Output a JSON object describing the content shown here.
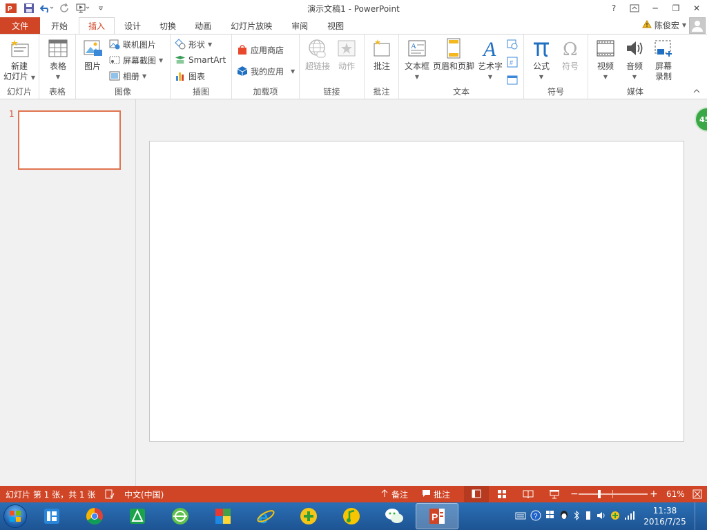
{
  "window": {
    "title": "演示文稿1 - PowerPoint",
    "help": "?",
    "minimize": "─",
    "restore": "❐",
    "close": "✕"
  },
  "tabs": [
    {
      "label": "文件"
    },
    {
      "label": "开始"
    },
    {
      "label": "插入"
    },
    {
      "label": "设计"
    },
    {
      "label": "切换"
    },
    {
      "label": "动画"
    },
    {
      "label": "幻灯片放映"
    },
    {
      "label": "审阅"
    },
    {
      "label": "视图"
    }
  ],
  "user": {
    "name": "陈俊宏"
  },
  "ribbon": {
    "groups": {
      "slides": "幻灯片",
      "tables": "表格",
      "images": "图像",
      "illustrations": "插图",
      "addins": "加载项",
      "links": "链接",
      "comments": "批注",
      "text": "文本",
      "symbols": "符号",
      "media": "媒体"
    },
    "buttons": {
      "new_slide_1": "新建",
      "new_slide_2": "幻灯片",
      "table": "表格",
      "picture": "图片",
      "online_pictures": "联机图片",
      "screenshot": "屏幕截图",
      "album": "相册",
      "shapes": "形状",
      "smartart": "SmartArt",
      "chart": "图表",
      "store": "应用商店",
      "my_apps": "我的应用",
      "hyperlink": "超链接",
      "action": "动作",
      "comment": "批注",
      "textbox": "文本框",
      "header_footer": "页眉和页脚",
      "wordart": "艺术字",
      "equation": "公式",
      "symbol": "符号",
      "video": "视频",
      "audio": "音频",
      "screen_recording_1": "屏幕",
      "screen_recording_2": "录制"
    }
  },
  "slides_pane": {
    "slide_number": "1"
  },
  "badge": {
    "value": "45"
  },
  "status": {
    "slide_info": "幻灯片 第 1 张，共 1 张",
    "language": "中文(中国)",
    "notes": "备注",
    "comments": "批注",
    "zoom_minus": "−",
    "zoom_plus": "+",
    "zoom": "61%",
    "zoom_level": 0.61
  },
  "taskbar": {
    "time": "11:38",
    "date": "2016/7/25"
  },
  "colors": {
    "accent": "#d04526",
    "taskbar": "#1d5493"
  }
}
